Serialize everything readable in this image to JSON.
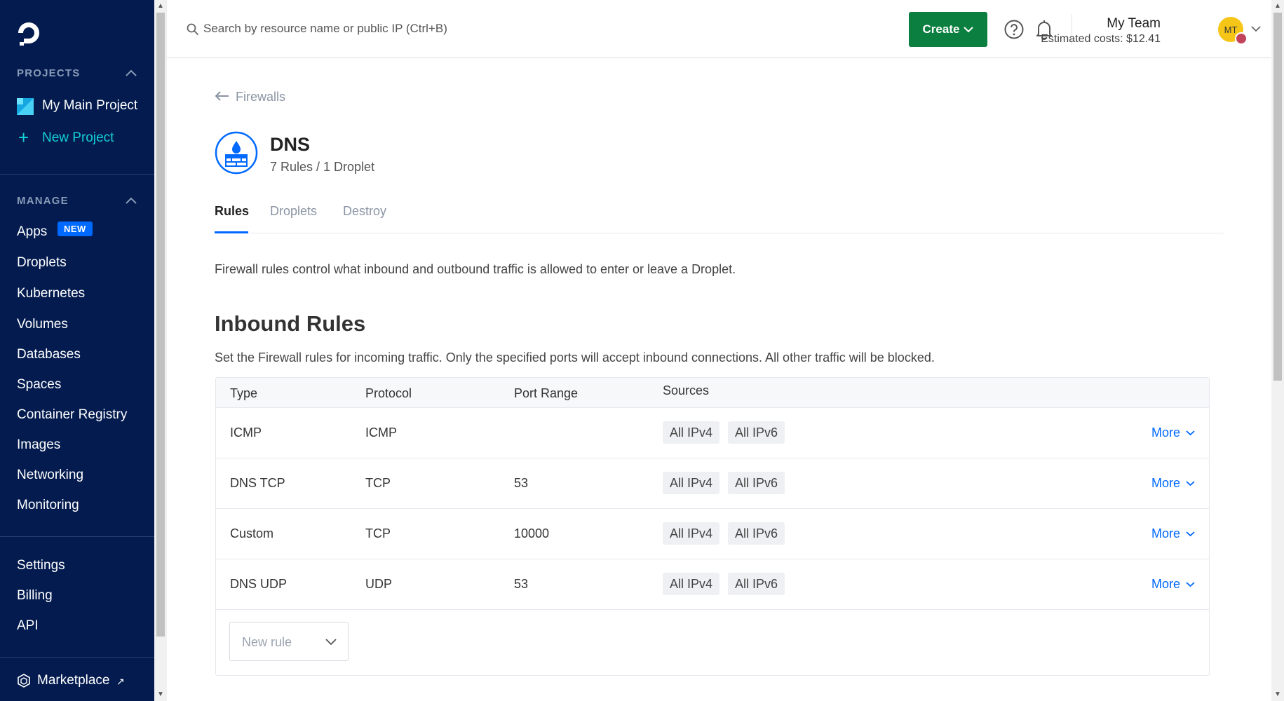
{
  "sidebar": {
    "projects_heading": "PROJECTS",
    "project_name": "My Main Project",
    "new_project": "New Project",
    "manage_heading": "MANAGE",
    "new_badge": "NEW",
    "manage_items": [
      "Apps",
      "Droplets",
      "Kubernetes",
      "Volumes",
      "Databases",
      "Spaces",
      "Container Registry",
      "Images",
      "Networking",
      "Monitoring"
    ],
    "account_items": [
      "Settings",
      "Billing",
      "API"
    ],
    "marketplace": "Marketplace"
  },
  "topbar": {
    "search_placeholder": "Search by resource name or public IP (Ctrl+B)",
    "create_label": "Create",
    "team_name": "My Team",
    "estimated_costs": "Estimated costs: $12.41",
    "avatar_initials": "MT"
  },
  "firewall": {
    "back_label": "Firewalls",
    "name": "DNS",
    "summary": "7 Rules / 1 Droplet",
    "tabs": [
      "Rules",
      "Droplets",
      "Destroy"
    ],
    "active_tab": "Rules",
    "description": "Firewall rules control what inbound and outbound traffic is allowed to enter or leave a Droplet."
  },
  "inbound": {
    "title": "Inbound Rules",
    "description": "Set the Firewall rules for incoming traffic. Only the specified ports will accept inbound connections. All other traffic will be blocked.",
    "columns": [
      "Type",
      "Protocol",
      "Port Range",
      "Sources"
    ],
    "rows": [
      {
        "type": "ICMP",
        "protocol": "ICMP",
        "port_range": "",
        "sources": [
          "All IPv4",
          "All IPv6"
        ],
        "action": "More"
      },
      {
        "type": "DNS TCP",
        "protocol": "TCP",
        "port_range": "53",
        "sources": [
          "All IPv4",
          "All IPv6"
        ],
        "action": "More"
      },
      {
        "type": "Custom",
        "protocol": "TCP",
        "port_range": "10000",
        "sources": [
          "All IPv4",
          "All IPv6"
        ],
        "action": "More"
      },
      {
        "type": "DNS UDP",
        "protocol": "UDP",
        "port_range": "53",
        "sources": [
          "All IPv4",
          "All IPv6"
        ],
        "action": "More"
      }
    ],
    "new_rule_placeholder": "New rule"
  },
  "colors": {
    "sidebar_bg": "#031b4e",
    "accent_blue": "#0069ff",
    "create_green": "#0a7f3f",
    "new_project_cyan": "#15d1d8"
  }
}
